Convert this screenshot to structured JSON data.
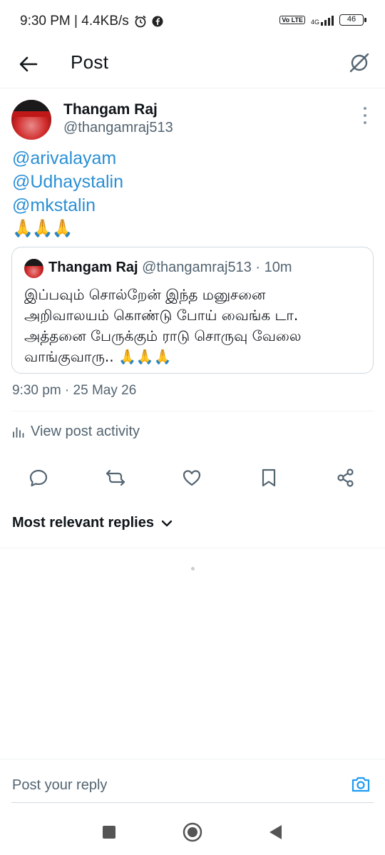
{
  "status_bar": {
    "time_speed": "9:30 PM | 4.4KB/s",
    "network": "4G",
    "volte": "Vo LTE",
    "battery": "46"
  },
  "app_bar": {
    "title": "Post"
  },
  "post": {
    "author_name": "Thangam Raj",
    "author_handle": "@thangamraj513",
    "mentions": [
      "@arivalayam",
      "@Udhaystalin",
      "@mkstalin"
    ],
    "emoji": "🙏🙏🙏",
    "timestamp": "9:30 pm · 25 May 26",
    "view_activity": "View post activity"
  },
  "quote": {
    "author_name": "Thangam Raj",
    "meta": "@thangamraj513 · 10m",
    "text_lines": [
      "இப்பவும் சொல்றேன் இந்த மனுசனை",
      "அறிவாலயம் கொண்டு போய் வைங்க டா.",
      "அத்தனை பேருக்கும் ராடு சொருவு வேலை",
      "வாங்குவாரு.. 🙏🙏🙏"
    ]
  },
  "replies": {
    "sort_label": "Most relevant replies"
  },
  "composer": {
    "placeholder": "Post your reply"
  },
  "colors": {
    "accent": "#1d9bf0",
    "secondary_text": "#536471",
    "border": "#cfd9de"
  }
}
